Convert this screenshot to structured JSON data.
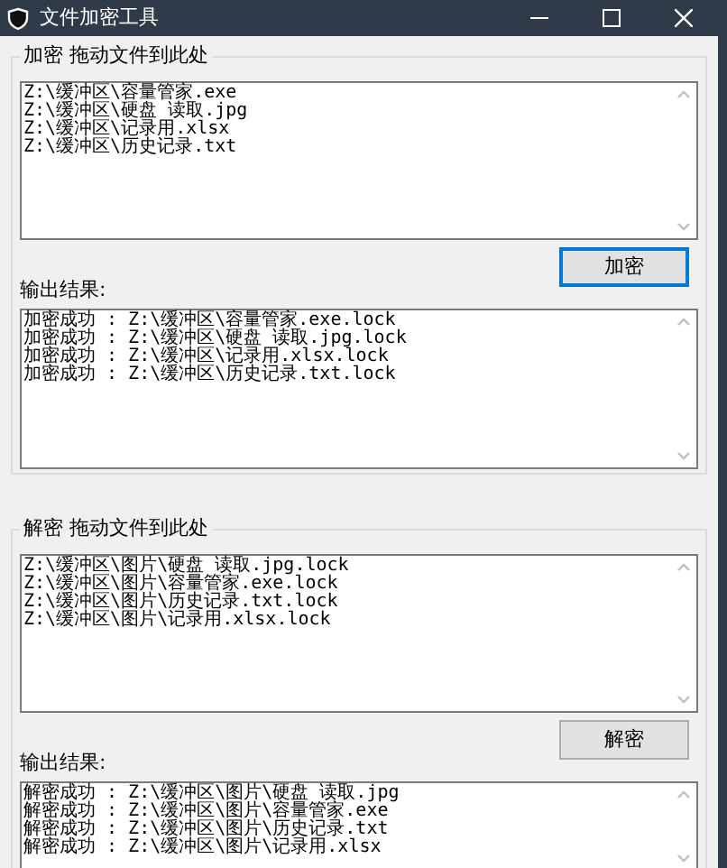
{
  "window": {
    "title": "文件加密工具"
  },
  "sections": [
    {
      "label": "加密 拖动文件到此处",
      "input_lines": [
        "Z:\\缓冲区\\容量管家.exe",
        "Z:\\缓冲区\\硬盘 读取.jpg",
        "Z:\\缓冲区\\记录用.xlsx",
        "Z:\\缓冲区\\历史记录.txt"
      ],
      "button": {
        "label": "加密",
        "focused": true
      },
      "output_label": "输出结果:",
      "output_lines": [
        "加密成功 : Z:\\缓冲区\\容量管家.exe.lock",
        "加密成功 : Z:\\缓冲区\\硬盘 读取.jpg.lock",
        "加密成功 : Z:\\缓冲区\\记录用.xlsx.lock",
        "加密成功 : Z:\\缓冲区\\历史记录.txt.lock"
      ]
    },
    {
      "label": "解密 拖动文件到此处",
      "input_lines": [
        "Z:\\缓冲区\\图片\\硬盘 读取.jpg.lock",
        "Z:\\缓冲区\\图片\\容量管家.exe.lock",
        "Z:\\缓冲区\\图片\\历史记录.txt.lock",
        "Z:\\缓冲区\\图片\\记录用.xlsx.lock"
      ],
      "button": {
        "label": "解密",
        "focused": false
      },
      "output_label": "输出结果:",
      "output_lines": [
        "解密成功 : Z:\\缓冲区\\图片\\硬盘 读取.jpg",
        "解密成功 : Z:\\缓冲区\\图片\\容量管家.exe",
        "解密成功 : Z:\\缓冲区\\图片\\历史记录.txt",
        "解密成功 : Z:\\缓冲区\\图片\\记录用.xlsx"
      ]
    }
  ]
}
